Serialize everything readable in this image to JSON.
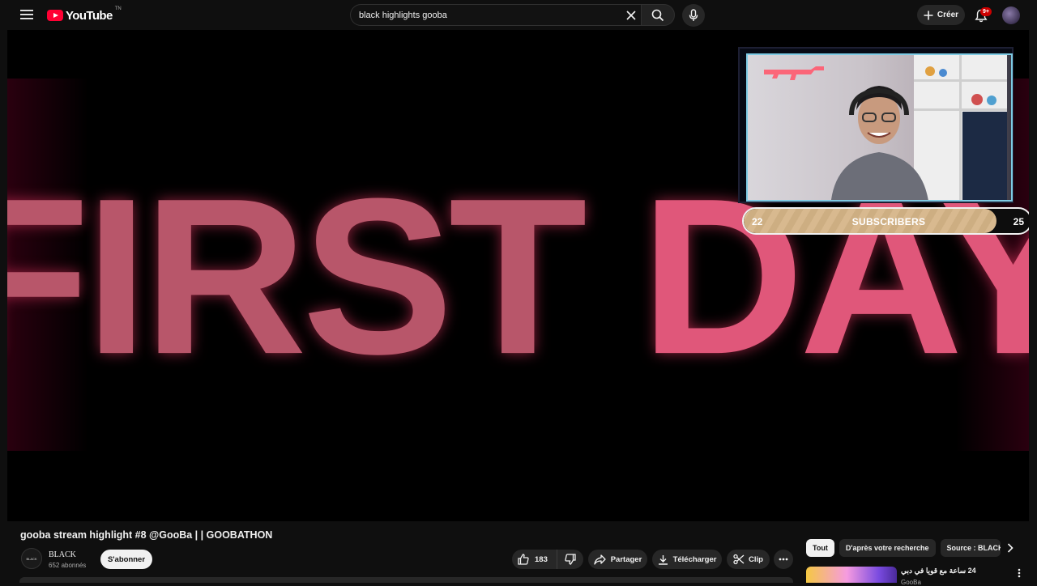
{
  "header": {
    "logo_text": "YouTube",
    "logo_region": "TN",
    "search_value": "black highlights gooba",
    "create_label": "Créer",
    "notification_badge": "9+"
  },
  "player": {
    "overlay_title_part1": "FIRST ",
    "overlay_title_part2": "DAY",
    "sub_goal": {
      "current": "22",
      "label": "SUBSCRIBERS",
      "target": "25",
      "progress_fraction": 0.88
    }
  },
  "video": {
    "title": "gooba stream highlight #8 @GooBa | | GOOBATHON",
    "channel_name": "BLACK",
    "channel_avatar_text": "BLACK",
    "subscribers": "652 abonnés",
    "subscribe_label": "S'abonner",
    "like_count": "183",
    "share_label": "Partager",
    "download_label": "Télécharger",
    "clip_label": "Clip"
  },
  "sidebar": {
    "chips": [
      {
        "label": "Tout",
        "active": true
      },
      {
        "label": "D'après votre recherche",
        "active": false
      },
      {
        "label": "Source : BLACK",
        "active": false
      }
    ],
    "recommendation": {
      "title": "24 ساعة مع قويا في دبي",
      "channel": "GooBa"
    }
  },
  "icons": {
    "menu": "hamburger-icon",
    "search": "search-icon",
    "clear": "close-icon",
    "mic": "mic-icon",
    "create": "plus-icon",
    "bell": "bell-icon",
    "like": "thumbs-up-icon",
    "dislike": "thumbs-down-icon",
    "share": "share-icon",
    "download": "download-icon",
    "clip": "scissors-icon",
    "more": "more-horizontal-icon",
    "chip_next": "chevron-right-icon",
    "rec_menu": "more-vertical-icon"
  },
  "colors": {
    "background": "#0f0f0f",
    "brand_red": "#ff0033",
    "overlay_title": "#d4566f",
    "sub_bar_fill": "#d8b98f",
    "cam_border": "#7ecbe4"
  }
}
